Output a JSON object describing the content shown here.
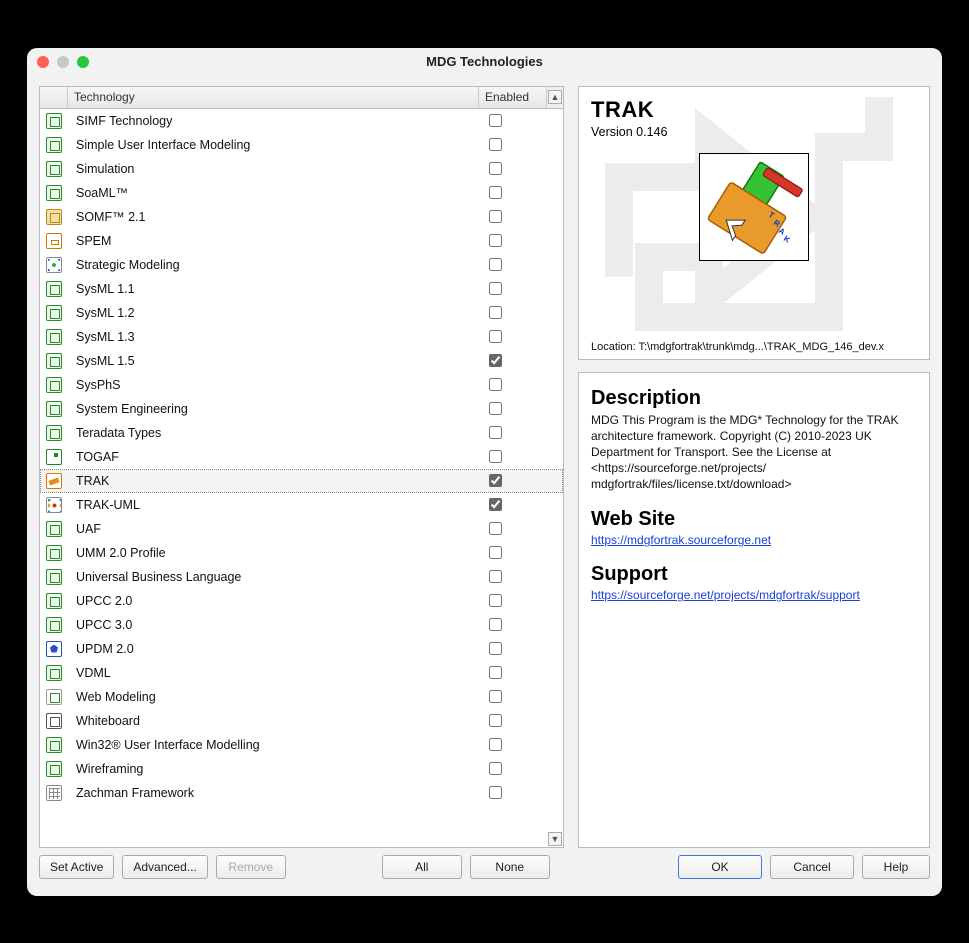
{
  "window": {
    "title": "MDG Technologies"
  },
  "table": {
    "headers": {
      "technology": "Technology",
      "enabled": "Enabled"
    },
    "rows": [
      {
        "name": "SIMF Technology",
        "enabled": false,
        "icon": "default"
      },
      {
        "name": "Simple User Interface Modeling",
        "enabled": false,
        "icon": "default"
      },
      {
        "name": "Simulation",
        "enabled": false,
        "icon": "default"
      },
      {
        "name": "SoaML™",
        "enabled": false,
        "icon": "default"
      },
      {
        "name": "SOMF™ 2.1",
        "enabled": false,
        "icon": "somf"
      },
      {
        "name": "SPEM",
        "enabled": false,
        "icon": "spem"
      },
      {
        "name": "Strategic Modeling",
        "enabled": false,
        "icon": "strategic"
      },
      {
        "name": "SysML 1.1",
        "enabled": false,
        "icon": "default"
      },
      {
        "name": "SysML 1.2",
        "enabled": false,
        "icon": "default"
      },
      {
        "name": "SysML 1.3",
        "enabled": false,
        "icon": "default"
      },
      {
        "name": "SysML 1.5",
        "enabled": true,
        "icon": "default"
      },
      {
        "name": "SysPhS",
        "enabled": false,
        "icon": "default"
      },
      {
        "name": "System Engineering",
        "enabled": false,
        "icon": "default"
      },
      {
        "name": "Teradata Types",
        "enabled": false,
        "icon": "default"
      },
      {
        "name": "TOGAF",
        "enabled": false,
        "icon": "togaf"
      },
      {
        "name": "TRAK",
        "enabled": true,
        "icon": "trak",
        "selected": true
      },
      {
        "name": "TRAK-UML",
        "enabled": true,
        "icon": "trakuml"
      },
      {
        "name": "UAF",
        "enabled": false,
        "icon": "default"
      },
      {
        "name": "UMM 2.0 Profile",
        "enabled": false,
        "icon": "default"
      },
      {
        "name": "Universal Business Language",
        "enabled": false,
        "icon": "default"
      },
      {
        "name": "UPCC 2.0",
        "enabled": false,
        "icon": "default"
      },
      {
        "name": "UPCC 3.0",
        "enabled": false,
        "icon": "default"
      },
      {
        "name": "UPDM 2.0",
        "enabled": false,
        "icon": "updm"
      },
      {
        "name": "VDML",
        "enabled": false,
        "icon": "default"
      },
      {
        "name": "Web Modeling",
        "enabled": false,
        "icon": "web"
      },
      {
        "name": "Whiteboard",
        "enabled": false,
        "icon": "whiteboard"
      },
      {
        "name": "Win32® User Interface Modelling",
        "enabled": false,
        "icon": "default"
      },
      {
        "name": "Wireframing",
        "enabled": false,
        "icon": "default"
      },
      {
        "name": "Zachman Framework",
        "enabled": false,
        "icon": "zachman"
      }
    ]
  },
  "detail": {
    "name": "TRAK",
    "version_label": "Version 0.146",
    "location_label": "Location: T:\\mdgfortrak\\trunk\\mdg...\\TRAK_MDG_146_dev.x",
    "description_heading": "Description",
    "description_text": "MDG This Program is the MDG* Technology for the TRAK architecture framework.  Copyright (C) 2010-2023 UK Department for Transport.  See the License at <https://sourceforge.net/projects/ mdgfortrak/files/license.txt/download>",
    "website_heading": "Web Site",
    "website_link": "https://mdgfortrak.sourceforge.net",
    "support_heading": "Support",
    "support_link": "https://sourceforge.net/projects/mdgfortrak/support"
  },
  "buttons": {
    "set_active": "Set Active",
    "advanced": "Advanced...",
    "remove": "Remove",
    "all": "All",
    "none": "None",
    "ok": "OK",
    "cancel": "Cancel",
    "help": "Help"
  }
}
